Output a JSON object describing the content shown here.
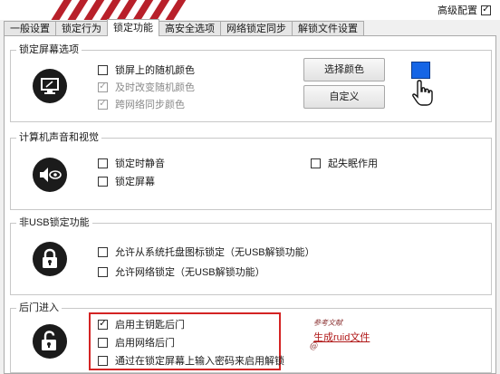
{
  "header": {
    "advanced_config_label": "高级配置",
    "advanced_config_checked": true
  },
  "tabs": [
    {
      "label": "一般设置"
    },
    {
      "label": "锁定行为"
    },
    {
      "label": "锁定功能",
      "active": true
    },
    {
      "label": "高安全选项"
    },
    {
      "label": "网络锁定同步"
    },
    {
      "label": "解锁文件设置"
    }
  ],
  "lock_screen": {
    "title": "锁定屏幕选项",
    "options": [
      {
        "label": "锁屏上的随机颜色",
        "checked": false,
        "enabled": true
      },
      {
        "label": "及时改变随机颜色",
        "checked": true,
        "enabled": false
      },
      {
        "label": "跨网络同步颜色",
        "checked": true,
        "enabled": false
      }
    ],
    "choose_color_button": "选择颜色",
    "custom_button": "自定义",
    "color": "#1565e6"
  },
  "sound": {
    "title": "计算机声音和视觉",
    "options": [
      {
        "label": "锁定时静音",
        "checked": false
      },
      {
        "label": "锁定屏幕",
        "checked": false
      },
      {
        "label": "起失眠作用",
        "checked": false
      }
    ]
  },
  "non_usb": {
    "title": "非USB锁定功能",
    "options": [
      {
        "label": "允许从系统托盘图标锁定（无USB解锁功能）",
        "checked": false
      },
      {
        "label": "允许网络锁定（无USB解锁功能）",
        "checked": false
      }
    ]
  },
  "backdoor": {
    "title": "后门进入",
    "options": [
      {
        "label": "启用主钥匙后门",
        "checked": true
      },
      {
        "label": "启用网络后门",
        "checked": false
      },
      {
        "label": "通过在锁定屏幕上输入密码来启用解锁",
        "checked": false
      }
    ],
    "note": "参考文献",
    "link": "生成ruid文件",
    "link_sub": "@"
  },
  "colors": {
    "highlight_border": "#d42424",
    "swatch": "#1565e6"
  }
}
